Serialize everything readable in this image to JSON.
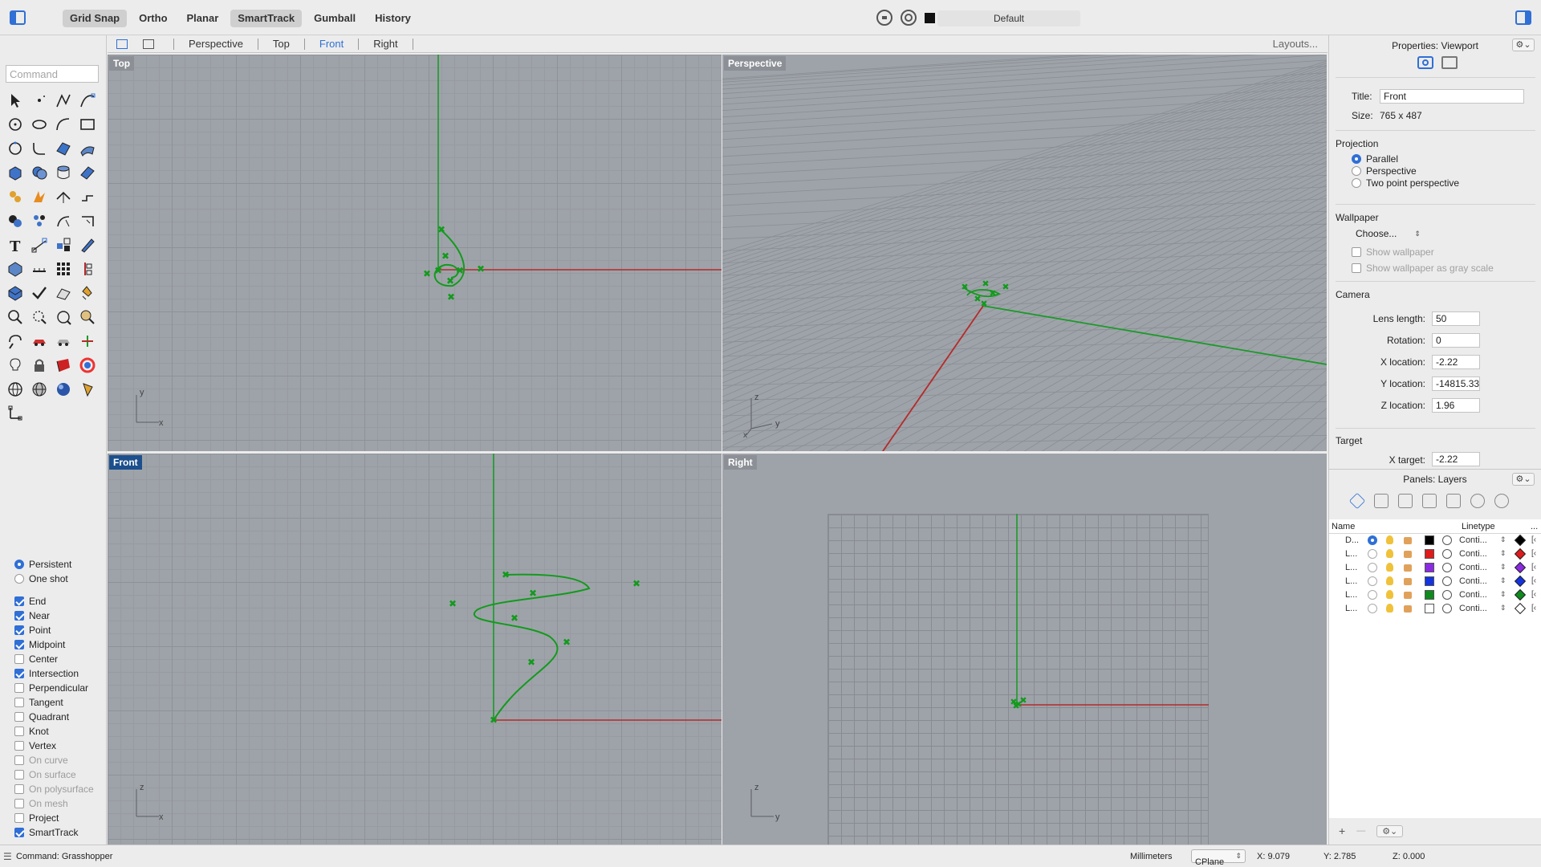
{
  "topbar": {
    "modes": [
      {
        "label": "Grid Snap",
        "active": true
      },
      {
        "label": "Ortho",
        "active": false
      },
      {
        "label": "Planar",
        "active": false
      },
      {
        "label": "SmartTrack",
        "active": true
      },
      {
        "label": "Gumball",
        "active": false
      },
      {
        "label": "History",
        "active": false
      }
    ],
    "layer_name": "Default"
  },
  "command": {
    "placeholder": "Command"
  },
  "tools": [
    "select-arrow",
    "point",
    "polyline",
    "curve-cp",
    "circle",
    "ellipse",
    "arc",
    "rectangle",
    "circle-3pt",
    "fillet-curve",
    "surface-corner",
    "surface-sweep",
    "box",
    "boolean-union",
    "cylinder",
    "extrude-surface",
    "solid-tools",
    "extrude-fire",
    "split-curve",
    "offset",
    "merge",
    "polycut",
    "fillet",
    "trim",
    "text",
    "dimension",
    "explode",
    "edit-pencil",
    "surface-box",
    "ruler",
    "array",
    "transform-axis",
    "extrude-box",
    "check",
    "analyze",
    "paint",
    "zoom-in",
    "zoom-window",
    "zoom-extents",
    "zoom-selected",
    "rotate-view",
    "car",
    "car-alt",
    "gumball-small",
    "light-bulb",
    "lock",
    "render-mat",
    "color-wheel",
    "sphere-wire",
    "sphere-grid",
    "sphere-shaded",
    "pen-cone",
    "cplane-axes"
  ],
  "osnap": {
    "mode": [
      {
        "label": "Persistent",
        "checked": true
      },
      {
        "label": "One shot",
        "checked": false
      }
    ],
    "items": [
      {
        "label": "End",
        "checked": true,
        "dim": false
      },
      {
        "label": "Near",
        "checked": true,
        "dim": false
      },
      {
        "label": "Point",
        "checked": true,
        "dim": false
      },
      {
        "label": "Midpoint",
        "checked": true,
        "dim": false
      },
      {
        "label": "Center",
        "checked": false,
        "dim": false
      },
      {
        "label": "Intersection",
        "checked": true,
        "dim": false
      },
      {
        "label": "Perpendicular",
        "checked": false,
        "dim": false
      },
      {
        "label": "Tangent",
        "checked": false,
        "dim": false
      },
      {
        "label": "Quadrant",
        "checked": false,
        "dim": false
      },
      {
        "label": "Knot",
        "checked": false,
        "dim": false
      },
      {
        "label": "Vertex",
        "checked": false,
        "dim": false
      },
      {
        "label": "On curve",
        "checked": false,
        "dim": true
      },
      {
        "label": "On surface",
        "checked": false,
        "dim": true
      },
      {
        "label": "On polysurface",
        "checked": false,
        "dim": true
      },
      {
        "label": "On mesh",
        "checked": false,
        "dim": true
      },
      {
        "label": "Project",
        "checked": false,
        "dim": false
      },
      {
        "label": "SmartTrack",
        "checked": true,
        "dim": false
      }
    ]
  },
  "viewport_tabs": {
    "tabs": [
      "Perspective",
      "Top",
      "Front",
      "Right"
    ],
    "active": "Front",
    "layouts": "Layouts..."
  },
  "viewports": {
    "top": {
      "label": "Top"
    },
    "perspective": {
      "label": "Perspective"
    },
    "front": {
      "label": "Front"
    },
    "right": {
      "label": "Right"
    }
  },
  "axes": {
    "x": "x",
    "y": "y",
    "z": "z"
  },
  "properties": {
    "panel_title": "Properties: Viewport",
    "gear": "⚙⌄",
    "title_label": "Title:",
    "title_value": "Front",
    "size_label": "Size:",
    "size_value": "765 x 487",
    "projection_header": "Projection",
    "projection_options": [
      {
        "label": "Parallel",
        "checked": true
      },
      {
        "label": "Perspective",
        "checked": false
      },
      {
        "label": "Two point perspective",
        "checked": false
      }
    ],
    "wallpaper_header": "Wallpaper",
    "wallpaper_choose": "Choose...",
    "wallpaper_show": "Show wallpaper",
    "wallpaper_gray": "Show wallpaper as gray scale",
    "camera_header": "Camera",
    "camera": [
      {
        "label": "Lens length:",
        "value": "50"
      },
      {
        "label": "Rotation:",
        "value": "0"
      },
      {
        "label": "X location:",
        "value": "-2.22"
      },
      {
        "label": "Y location:",
        "value": "-14815.33"
      },
      {
        "label": "Z location:",
        "value": "1.96"
      }
    ],
    "target_header": "Target",
    "target_x_label": "X target:",
    "target_x_value": "-2.22"
  },
  "layers": {
    "panel_title": "Panels: Layers",
    "gear": "⚙⌄",
    "columns": {
      "name": "Name",
      "linetype": "Linetype",
      "more": "..."
    },
    "rows": [
      {
        "name": "D...",
        "current": true,
        "color": "#000000",
        "linetype": "Conti...",
        "more": "[‹"
      },
      {
        "name": "L...",
        "current": false,
        "color": "#e01b1b",
        "linetype": "Conti...",
        "more": "[‹"
      },
      {
        "name": "L...",
        "current": false,
        "color": "#8a2be2",
        "linetype": "Conti...",
        "more": "[‹"
      },
      {
        "name": "L...",
        "current": false,
        "color": "#1434e0",
        "linetype": "Conti...",
        "more": "[‹"
      },
      {
        "name": "L...",
        "current": false,
        "color": "#0f8a1f",
        "linetype": "Conti...",
        "more": "[‹"
      },
      {
        "name": "L...",
        "current": false,
        "color": "#ffffff",
        "linetype": "Conti...",
        "more": "[‹"
      }
    ],
    "add": "+",
    "remove": "—",
    "footer_gear": "⚙⌄"
  },
  "status": {
    "command": "Command: Grasshopper",
    "units": "Millimeters",
    "cplane": "CPlane",
    "x": "X: 9.079",
    "y": "Y: 2.785",
    "z": "Z: 0.000"
  },
  "colors": {
    "accent": "#2f6fd6",
    "curve": "#139a1d",
    "x_axis": "#b42b2b",
    "y_axis": "#1c9a2a",
    "viewport_bg": "#9ea3a9"
  }
}
